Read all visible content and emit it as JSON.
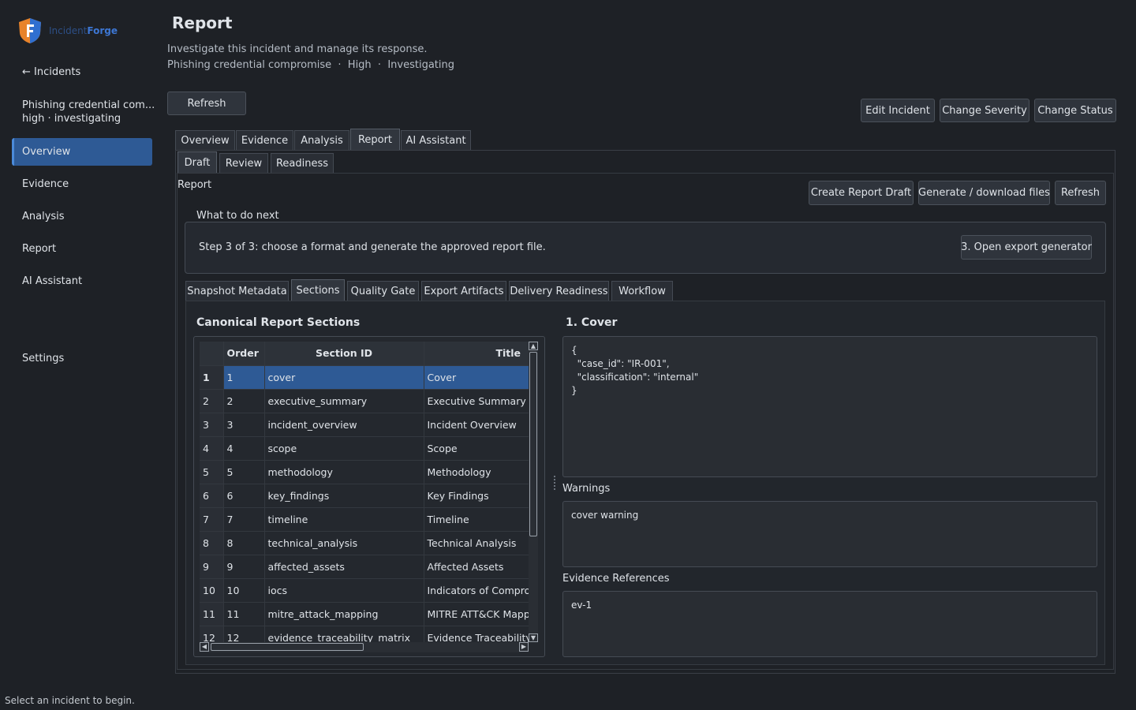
{
  "app": {
    "brand_prefix": "Incident",
    "brand_suffix": "Forge"
  },
  "sidebar": {
    "back_link": "← Incidents",
    "incident_title": "Phishing credential com...",
    "incident_meta": "high · investigating",
    "items": [
      {
        "label": "Overview",
        "active": true
      },
      {
        "label": "Evidence"
      },
      {
        "label": "Analysis"
      },
      {
        "label": "Report"
      },
      {
        "label": "AI Assistant"
      }
    ],
    "settings": "Settings"
  },
  "header": {
    "title": "Report",
    "subtitle": "Investigate this incident and manage its response.",
    "meta": "Phishing credential compromise  ·  High  ·  Investigating",
    "refresh": "Refresh",
    "edit_incident": "Edit Incident",
    "change_severity": "Change Severity",
    "change_status": "Change Status"
  },
  "main_tabs": [
    "Overview",
    "Evidence",
    "Analysis",
    "Report",
    "AI Assistant"
  ],
  "main_tab_selected": "Report",
  "report_tabs": [
    "Draft",
    "Review",
    "Readiness"
  ],
  "report_panel": {
    "label": "Report",
    "create_draft": "Create Report Draft",
    "generate": "Generate / download files",
    "refresh": "Refresh"
  },
  "next_step": {
    "legend": "What to do next",
    "text": "Step 3 of 3: choose a format and generate the approved report file.",
    "button": "3. Open export generator"
  },
  "draft_tabs": [
    "Snapshot Metadata",
    "Sections",
    "Quality Gate",
    "Export Artifacts",
    "Delivery Readiness",
    "Workflow"
  ],
  "draft_tab_selected": "Sections",
  "sections": {
    "heading": "Canonical Report Sections",
    "columns": [
      "Order",
      "Section ID",
      "Title"
    ],
    "rows": [
      {
        "n": "1",
        "order": "1",
        "id": "cover",
        "title": "Cover"
      },
      {
        "n": "2",
        "order": "2",
        "id": "executive_summary",
        "title": "Executive Summary"
      },
      {
        "n": "3",
        "order": "3",
        "id": "incident_overview",
        "title": "Incident Overview"
      },
      {
        "n": "4",
        "order": "4",
        "id": "scope",
        "title": "Scope"
      },
      {
        "n": "5",
        "order": "5",
        "id": "methodology",
        "title": "Methodology"
      },
      {
        "n": "6",
        "order": "6",
        "id": "key_findings",
        "title": "Key Findings"
      },
      {
        "n": "7",
        "order": "7",
        "id": "timeline",
        "title": "Timeline"
      },
      {
        "n": "8",
        "order": "8",
        "id": "technical_analysis",
        "title": "Technical Analysis"
      },
      {
        "n": "9",
        "order": "9",
        "id": "affected_assets",
        "title": "Affected Assets"
      },
      {
        "n": "10",
        "order": "10",
        "id": "iocs",
        "title": "Indicators of Compromise"
      },
      {
        "n": "11",
        "order": "11",
        "id": "mitre_attack_mapping",
        "title": "MITRE ATT&CK Mapping"
      },
      {
        "n": "12",
        "order": "12",
        "id": "evidence_traceability_matrix",
        "title": "Evidence Traceability Matrix"
      }
    ]
  },
  "detail": {
    "heading": "1. Cover",
    "json_text": "{\n  \"case_id\": \"IR-001\",\n  \"classification\": \"internal\"\n}",
    "warnings_label": "Warnings",
    "warnings_text": "cover warning",
    "evidence_label": "Evidence References",
    "evidence_text": "ev-1"
  },
  "status_bar": "Select an incident to begin.",
  "colors": {
    "accent": "#2e5a95",
    "brand": "#3d77d4",
    "background": "#1e2126"
  }
}
